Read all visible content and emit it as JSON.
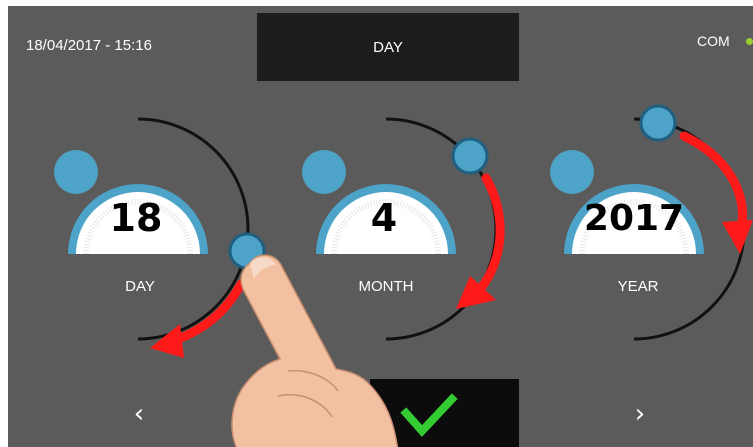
{
  "header": {
    "datetime": "18/04/2017 - 15:16",
    "title": "DAY",
    "status_label": "COM",
    "status_color": "#9acd32"
  },
  "dials": [
    {
      "id": "day",
      "label": "DAY",
      "value": "18"
    },
    {
      "id": "month",
      "label": "MONTH",
      "value": "4"
    },
    {
      "id": "year",
      "label": "YEAR",
      "value": "2017"
    }
  ],
  "footer": {
    "prev_icon": "chevron-left-icon",
    "next_icon": "chevron-right-icon",
    "confirm_icon": "checkmark-icon"
  },
  "colors": {
    "background": "#5b5b5b",
    "knob": "#4ea3c9",
    "arrow": "#ff1a1a",
    "confirm": "#33cc33"
  }
}
